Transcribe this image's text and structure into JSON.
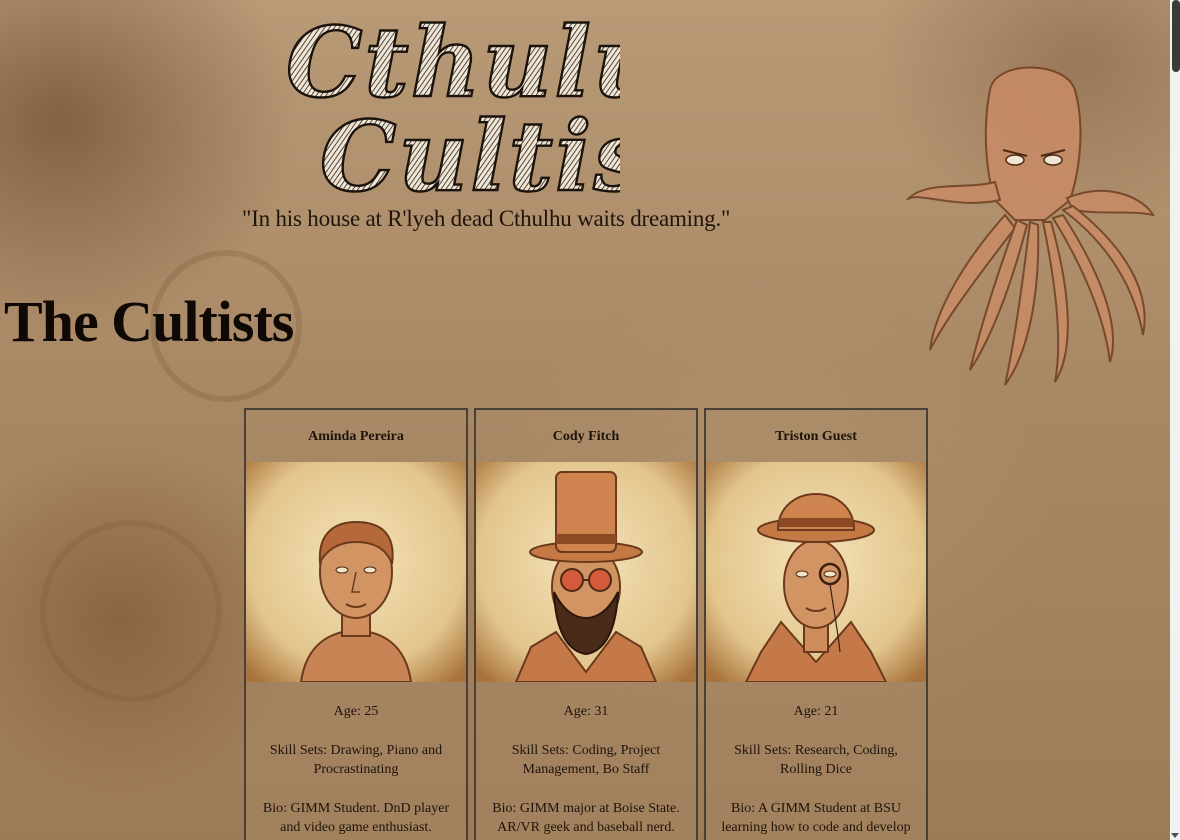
{
  "site": {
    "title_line1": "Cthulu",
    "title_line2": "Cultists",
    "tagline": "\"In his house at R'lyeh dead Cthulhu waits dreaming.\""
  },
  "section": {
    "heading": "The Cultists"
  },
  "cultists": [
    {
      "name": "Aminda Pereira",
      "age": "Age: 25",
      "skills": "Skill Sets: Drawing, Piano and Procrastinating",
      "bio": "Bio: GIMM Student. DnD player and video game enthusiast.",
      "portrait": "portrait-bare-head"
    },
    {
      "name": "Cody Fitch",
      "age": "Age: 31",
      "skills": "Skill Sets: Coding, Project Management, Bo Staff",
      "bio": "Bio: GIMM major at Boise State. AR/VR geek and baseball nerd.",
      "portrait": "portrait-top-hat-sunglasses"
    },
    {
      "name": "Triston Guest",
      "age": "Age: 21",
      "skills": "Skill Sets: Research, Coding, Rolling Dice",
      "bio": "Bio: A GIMM Student at BSU learning how to code and develop games. Avid lorefreak.",
      "portrait": "portrait-bowler-monocle"
    }
  ],
  "colors": {
    "parchment": "#a98865",
    "ink": "#1e140c",
    "card_border": "#4a4038",
    "sepia_skin": "#c98456"
  },
  "icons": {
    "mascot": "cthulhu-octopus-icon"
  }
}
